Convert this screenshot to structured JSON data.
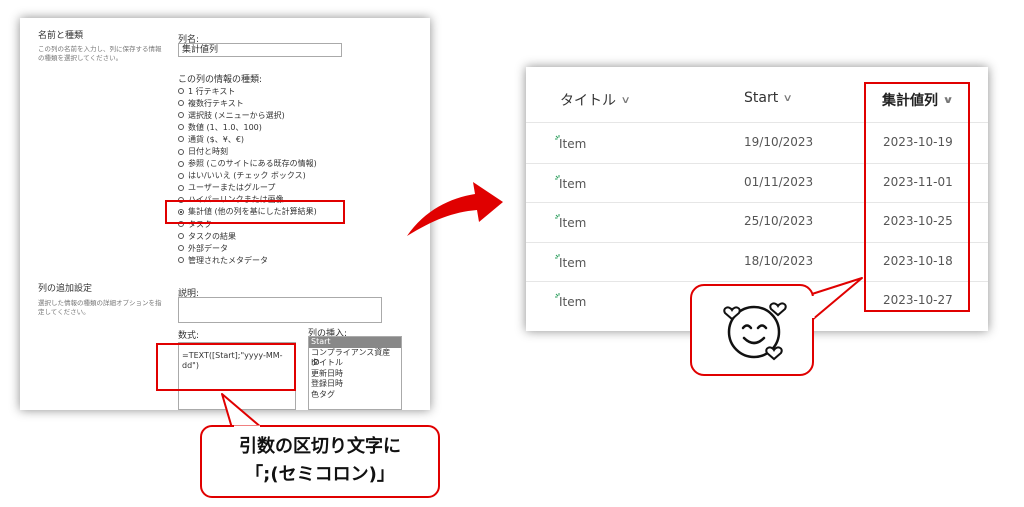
{
  "form": {
    "section_name_heading": "名前と種類",
    "section_name_desc": "この列の名前を入力し、列に保存する情報の種類を選択してください。",
    "column_name_label": "列名:",
    "column_name_value": "集計値列",
    "type_label": "この列の情報の種類:",
    "types": [
      {
        "label": "1 行テキスト",
        "checked": false
      },
      {
        "label": "複数行テキスト",
        "checked": false
      },
      {
        "label": "選択肢 (メニューから選択)",
        "checked": false
      },
      {
        "label": "数値 (1、1.0、100)",
        "checked": false
      },
      {
        "label": "通貨 ($、¥、€)",
        "checked": false
      },
      {
        "label": "日付と時刻",
        "checked": false
      },
      {
        "label": "参照 (このサイトにある既存の情報)",
        "checked": false
      },
      {
        "label": "はい/いいえ (チェック ボックス)",
        "checked": false
      },
      {
        "label": "ユーザーまたはグループ",
        "checked": false
      },
      {
        "label": "ハイパーリンクまたは画像",
        "checked": false
      },
      {
        "label": "集計値 (他の列を基にした計算結果)",
        "checked": true
      },
      {
        "label": "タスク",
        "checked": false
      },
      {
        "label": "タスクの結果",
        "checked": false
      },
      {
        "label": "外部データ",
        "checked": false
      },
      {
        "label": "管理されたメタデータ",
        "checked": false
      }
    ],
    "section_extra_heading": "列の追加設定",
    "section_extra_desc": "選択した情報の種類の詳細オプションを指定してください。",
    "description_label": "説明:",
    "formula_label": "数式:",
    "formula_value": "=TEXT([Start];\"yyyy-MM-dd\")",
    "insert_column_label": "列の挿入:",
    "insert_columns": [
      "Start",
      "コンプライアンス資産 ID",
      "タイトル",
      "更新日時",
      "登録日時",
      "色タグ"
    ],
    "insert_selected": "Start"
  },
  "callout": {
    "line1": "引数の区切り文字に",
    "line2": "「;(セミコロン)」"
  },
  "list": {
    "headers": {
      "title": "タイトル",
      "start": "Start",
      "calc": "集計値列"
    },
    "rows": [
      {
        "title": "Item",
        "start": "19/10/2023",
        "calc": "2023-10-19"
      },
      {
        "title": "Item",
        "start": "01/11/2023",
        "calc": "2023-11-01"
      },
      {
        "title": "Item",
        "start": "25/10/2023",
        "calc": "2023-10-25"
      },
      {
        "title": "Item",
        "start": "18/10/2023",
        "calc": "2023-10-18"
      },
      {
        "title": "Item",
        "start": "",
        "calc": "2023-10-27"
      }
    ]
  },
  "colors": {
    "highlight": "#e00000",
    "arrow": "#e00000"
  },
  "icons": {
    "emoji": "smiling-face-with-hearts-icon",
    "chevron": "chevron-down-icon",
    "item": "new-item-sparkle-icon"
  }
}
